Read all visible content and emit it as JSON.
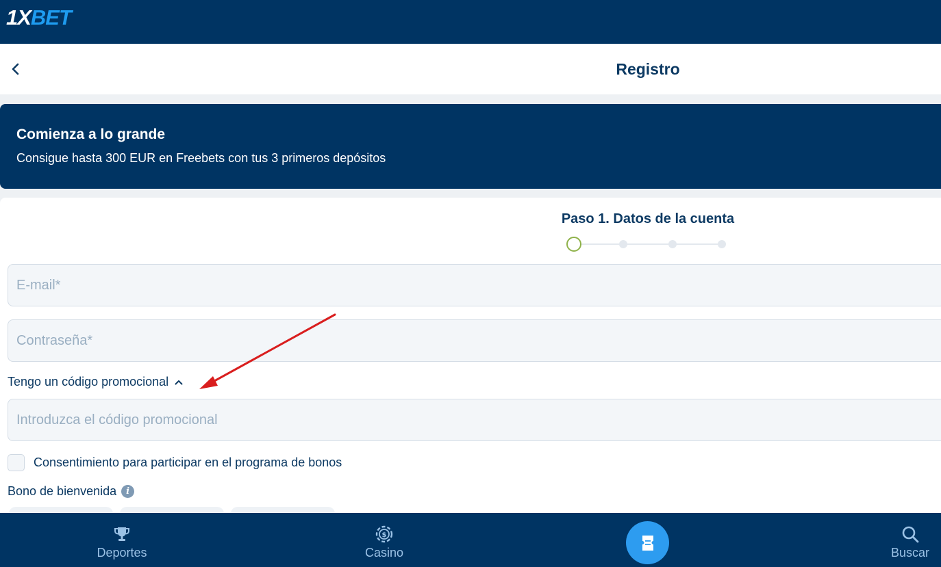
{
  "brand": {
    "logo_part1": "1X",
    "logo_part2": "BET",
    "primary_color": "#003463",
    "accent_color": "#2d9cf0"
  },
  "header": {
    "title": "Registro",
    "back_icon": "chevron-left-icon"
  },
  "banner": {
    "title": "Comienza a lo grande",
    "subtitle": "Consigue hasta 300 EUR en Freebets con tus 3 primeros depósitos"
  },
  "form": {
    "step_title": "Paso 1. Datos de la cuenta",
    "current_step": 1,
    "total_steps": 4,
    "email_placeholder": "E-mail*",
    "password_placeholder": "Contraseña*",
    "promo_toggle_label": "Tengo un código promocional",
    "promo_placeholder": "Introduzca el código promocional",
    "consent_label": "Consentimiento para participar en el programa de bonos",
    "consent_checked": false,
    "bonus_label": "Bono de bienvenida"
  },
  "bottom_nav": {
    "items": [
      {
        "label": "Deportes",
        "icon": "trophy-icon"
      },
      {
        "label": "Casino",
        "icon": "casino-chip-icon"
      },
      {
        "label": "",
        "icon": "bet-slip-icon"
      },
      {
        "label": "Buscar",
        "icon": "search-icon"
      }
    ]
  }
}
